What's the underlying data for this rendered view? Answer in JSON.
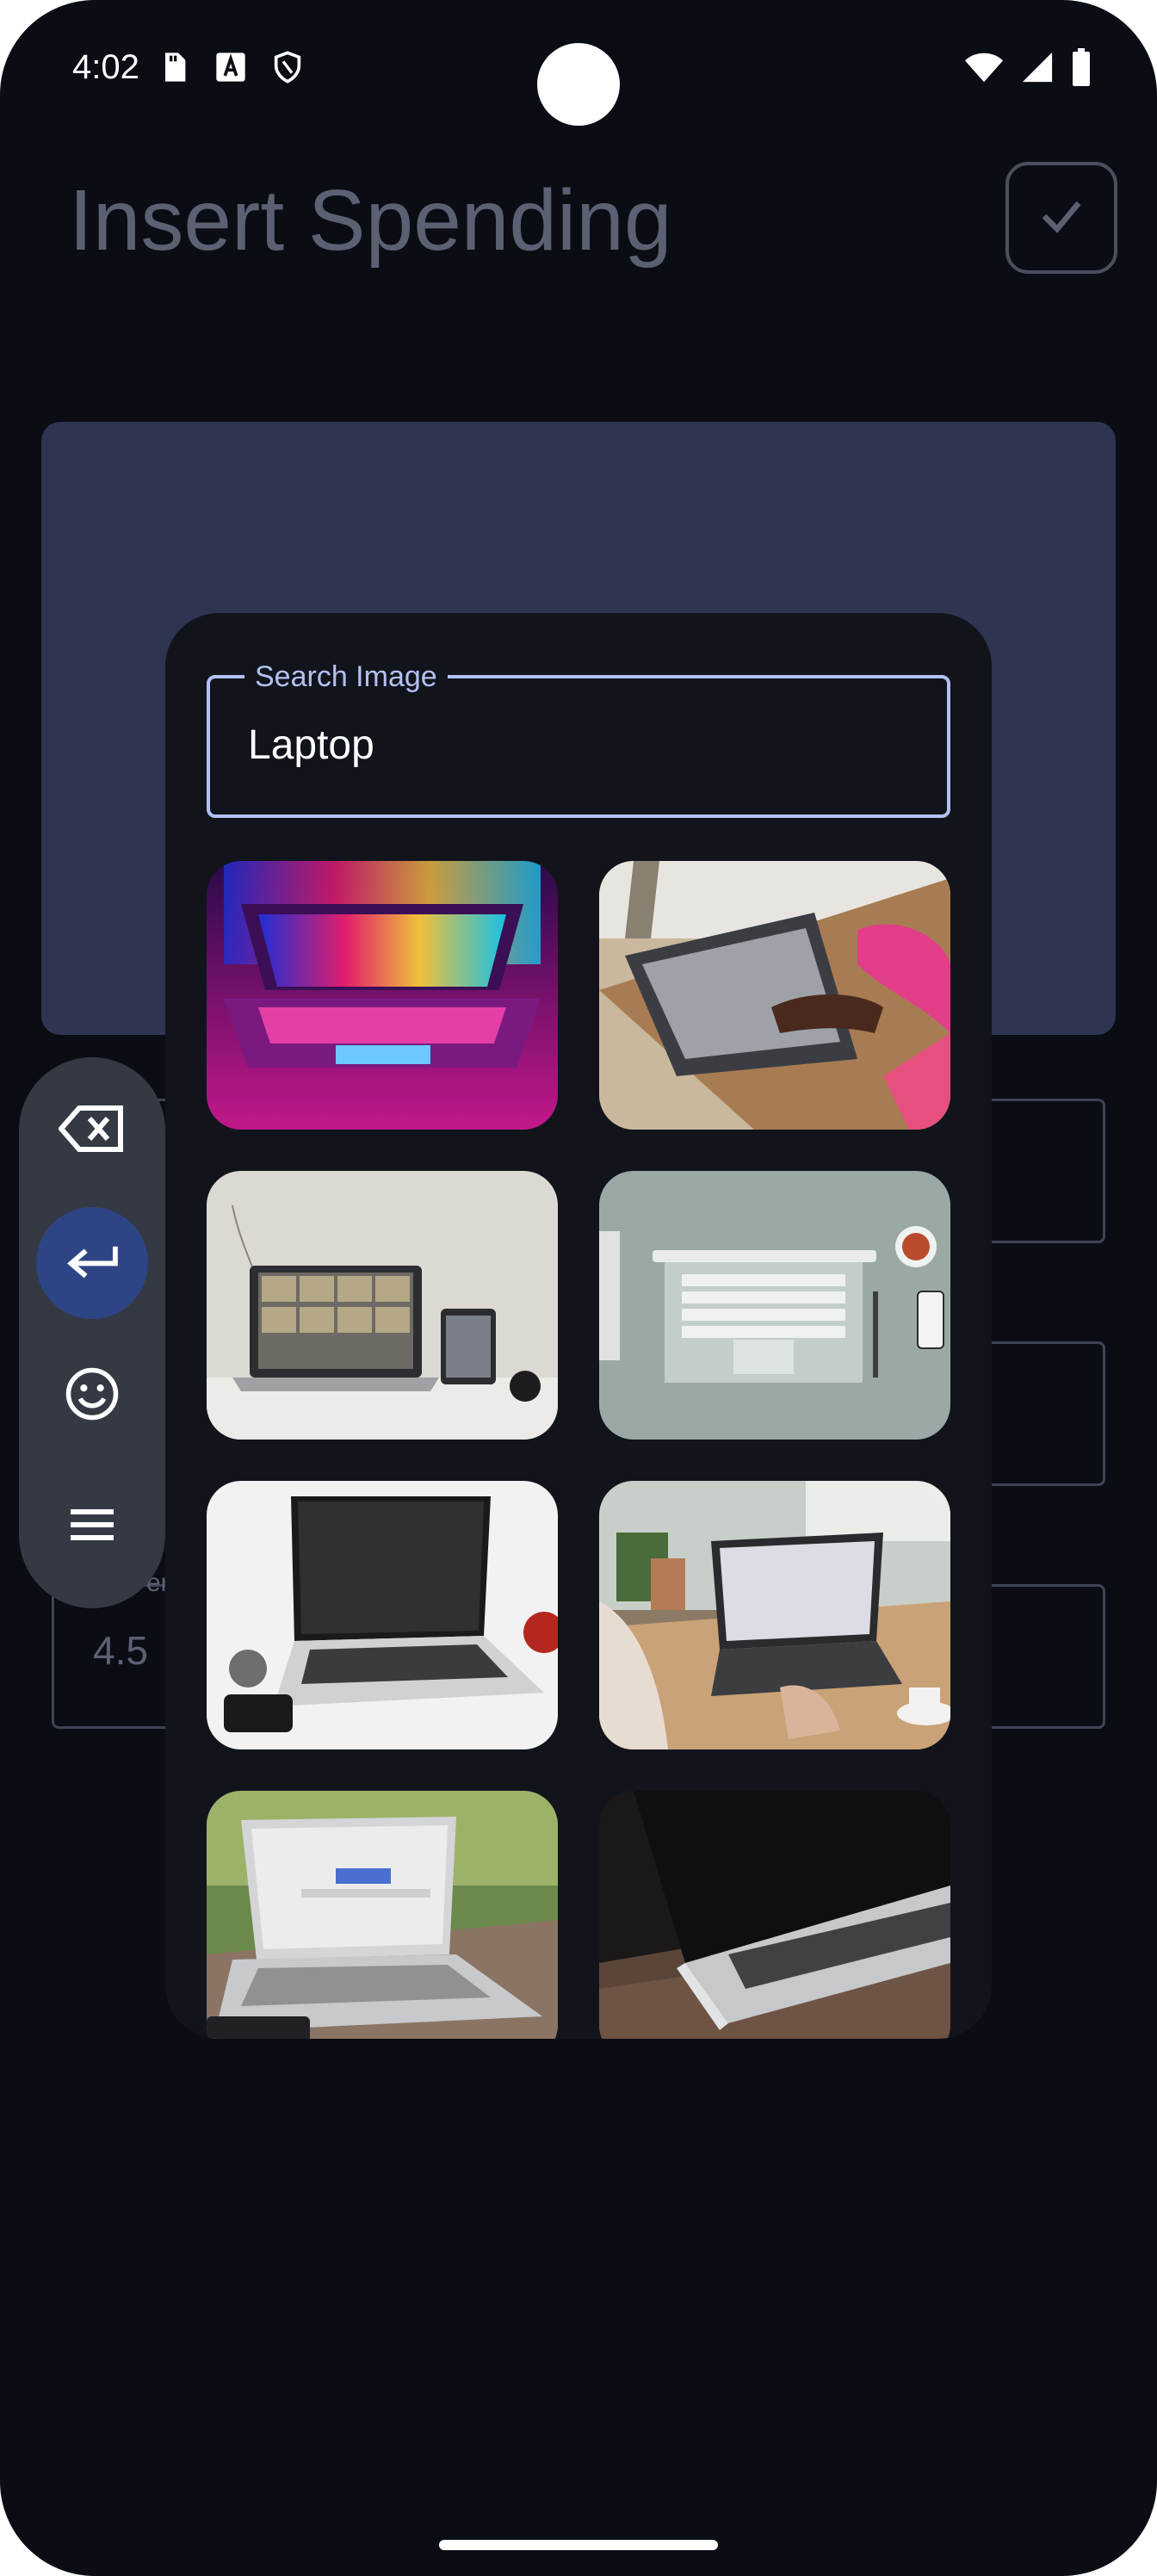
{
  "status_bar": {
    "time": "4:02",
    "left_icons": [
      "sd-card-icon",
      "font-a-icon",
      "shield-icon"
    ],
    "right_icons": [
      "wifi-icon",
      "signal-icon",
      "battery-icon"
    ]
  },
  "background_screen": {
    "title": "Insert Spending",
    "save_icon": "check-icon",
    "amount_label": "er",
    "amount_value": "4.5"
  },
  "keyboard_toolbar": {
    "buttons": [
      "backspace-icon",
      "enter-icon",
      "emoji-icon",
      "menu-icon"
    ]
  },
  "image_search_dialog": {
    "search_label": "Search Image",
    "search_value": "Laptop",
    "results": [
      {
        "description": "colorful glowing laptop"
      },
      {
        "description": "hands typing on laptop"
      },
      {
        "description": "laptop and tablet on desk"
      },
      {
        "description": "flat laptop illustration"
      },
      {
        "description": "silver laptop with phone and apple"
      },
      {
        "description": "person using laptop on wooden table"
      },
      {
        "description": "laptop showing google page outdoors"
      },
      {
        "description": "laptop keyboard close up"
      }
    ]
  },
  "colors": {
    "accent": "#b2c1f1",
    "dialog_bg": "#12141c",
    "screen_bg": "#0b0d15",
    "toolbar_active": "#2e4585"
  }
}
